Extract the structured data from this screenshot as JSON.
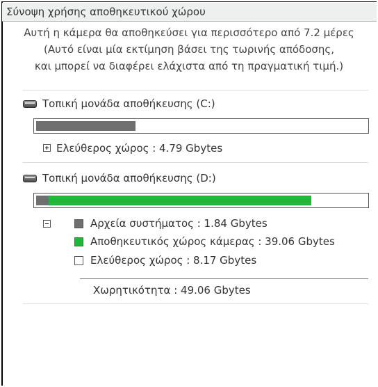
{
  "title": "Σύνοψη χρήσης αποθηκευτικού χώρου",
  "summary": {
    "line1": "Αυτή η κάμερα θα αποθηκεύσει για περισσότερο από 7.2 μέρες",
    "line2": "(Αυτό είναι μία εκτίμηση βάσει της τωρινής απόδοσης,",
    "line3": "και μπορεί να διαφέρει ελάχιστα από τη πραγματική τιμή.)"
  },
  "drive_c": {
    "label": "Τοπική μονάδα αποθήκευσης (C:)",
    "used_fraction": 0.3,
    "used_color": "#707070",
    "free_label": "Ελεύθερος χώρος : 4.79 Gbytes",
    "expander": "+"
  },
  "drive_d": {
    "label": "Τοπική μονάδα αποθήκευσης (D:)",
    "system_fraction": 0.0375,
    "camera_fraction": 0.7961,
    "system_color": "#6f6f6f",
    "camera_color": "#22b63a",
    "expander": "-",
    "legend": {
      "system": "Αρχεία συστήματος : 1.84 Gbytes",
      "camera": "Αποθηκευτικός χώρος κάμερας : 39.06 Gbytes",
      "free": "Ελεύθερος χώρος : 8.17 Gbytes"
    },
    "capacity": "Χωρητικότητα : 49.06 Gbytes"
  },
  "icons": [
    "hard-drive-icon",
    "expand-plus-icon",
    "collapse-minus-icon"
  ]
}
